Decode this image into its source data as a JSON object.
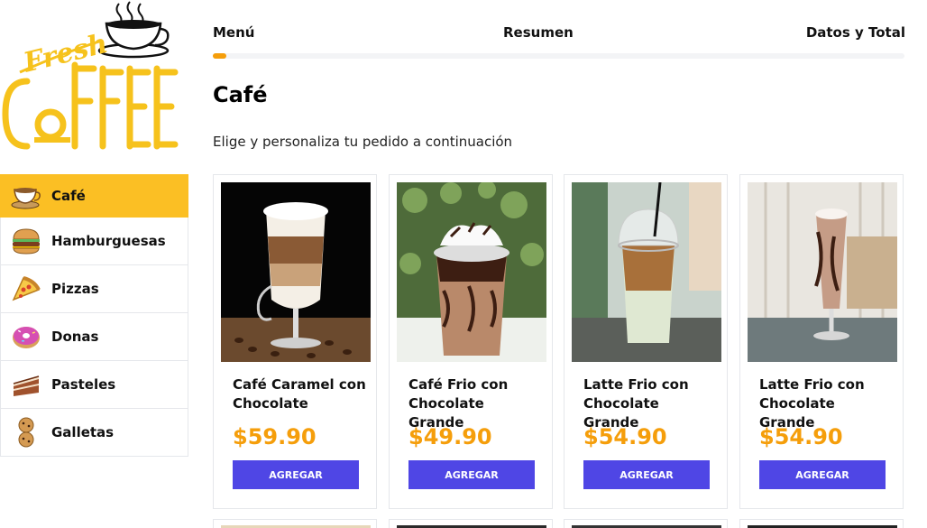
{
  "logo": {
    "script_text": "Fresh",
    "word": "COFFEE"
  },
  "sidebar": {
    "items": [
      {
        "label": "Café",
        "icon": "coffee-cup-icon",
        "active": true
      },
      {
        "label": "Hamburguesas",
        "icon": "burger-icon",
        "active": false
      },
      {
        "label": "Pizzas",
        "icon": "pizza-icon",
        "active": false
      },
      {
        "label": "Donas",
        "icon": "donut-icon",
        "active": false
      },
      {
        "label": "Pasteles",
        "icon": "cake-icon",
        "active": false
      },
      {
        "label": "Galletas",
        "icon": "cookies-icon",
        "active": false
      }
    ]
  },
  "steps": {
    "step1": "Menú",
    "step2": "Resumen",
    "step3": "Datos y Total",
    "progress_fraction": 0.02
  },
  "main": {
    "title": "Café",
    "subtitle": "Elige y personaliza tu pedido a continuación"
  },
  "products": [
    {
      "name": "Café Caramel con Chocolate",
      "price": "$59.90",
      "button": "AGREGAR"
    },
    {
      "name": "Café Frio con Chocolate Grande",
      "price": "$49.90",
      "button": "AGREGAR"
    },
    {
      "name": "Latte Frio con Chocolate Grande",
      "price": "$54.90",
      "button": "AGREGAR"
    },
    {
      "name": "Latte Frio con Chocolate Grande",
      "price": "$54.90",
      "button": "AGREGAR"
    }
  ],
  "colors": {
    "accent": "#fbbf24",
    "price": "#f59e0b",
    "button": "#4f46e5",
    "progress": "#f59e0b"
  }
}
